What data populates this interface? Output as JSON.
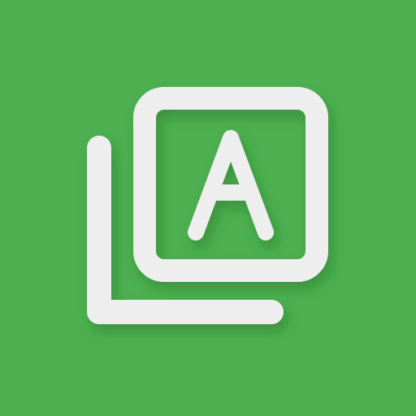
{
  "icon": {
    "name": "library-icon",
    "letter": "A",
    "background_color": "#4CAF50",
    "glyph_color": "#EEEEEE",
    "shadow_color": "#2E7D32"
  }
}
